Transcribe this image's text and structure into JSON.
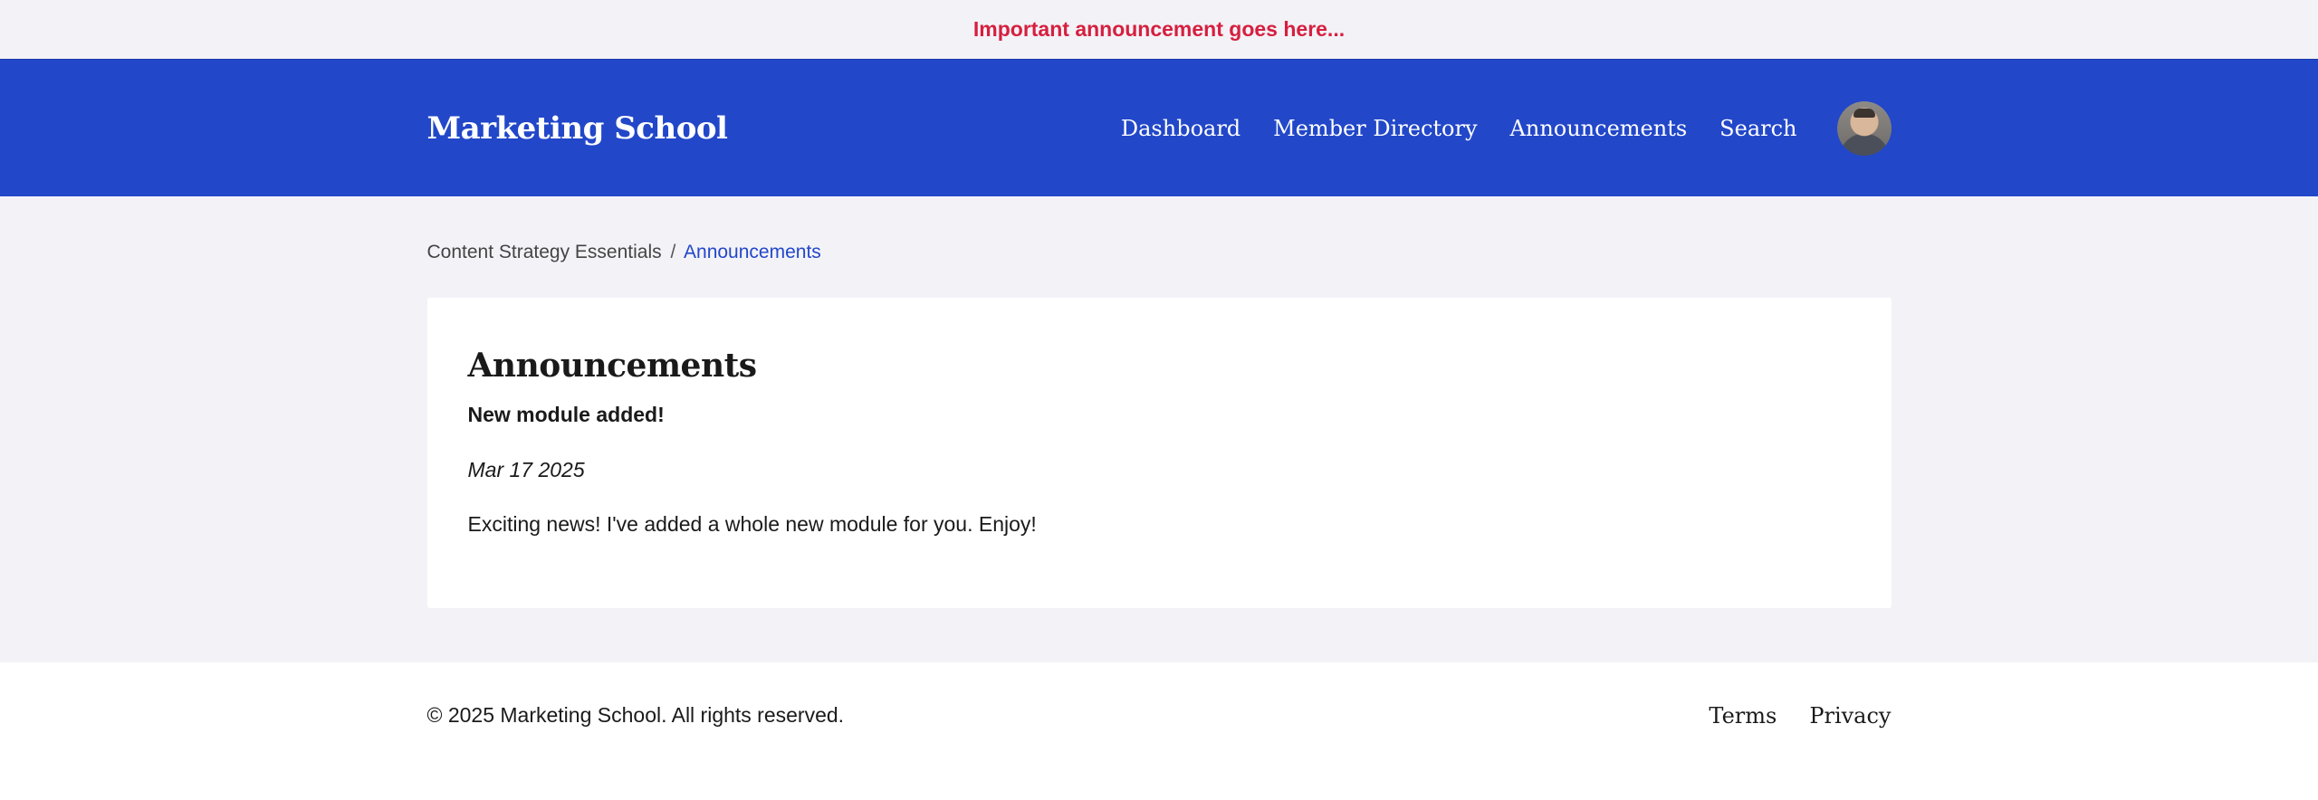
{
  "announcement": "Important announcement goes here...",
  "header": {
    "brand": "Marketing School",
    "nav": [
      "Dashboard",
      "Member Directory",
      "Announcements",
      "Search"
    ]
  },
  "breadcrumb": {
    "course": "Content Strategy Essentials",
    "separator": "/",
    "current": "Announcements"
  },
  "main": {
    "heading": "Announcements",
    "post": {
      "title": "New module added!",
      "date": "Mar 17 2025",
      "body": "Exciting news! I've added a whole new module for you. Enjoy!"
    }
  },
  "footer": {
    "copyright": "© 2025 Marketing School. All rights reserved.",
    "links": [
      "Terms",
      "Privacy"
    ]
  },
  "colors": {
    "brand_blue": "#2247c9",
    "announcement_red": "#d61f3f",
    "page_bg": "#f3f2f7"
  },
  "icons": {
    "avatar": "user-avatar"
  }
}
